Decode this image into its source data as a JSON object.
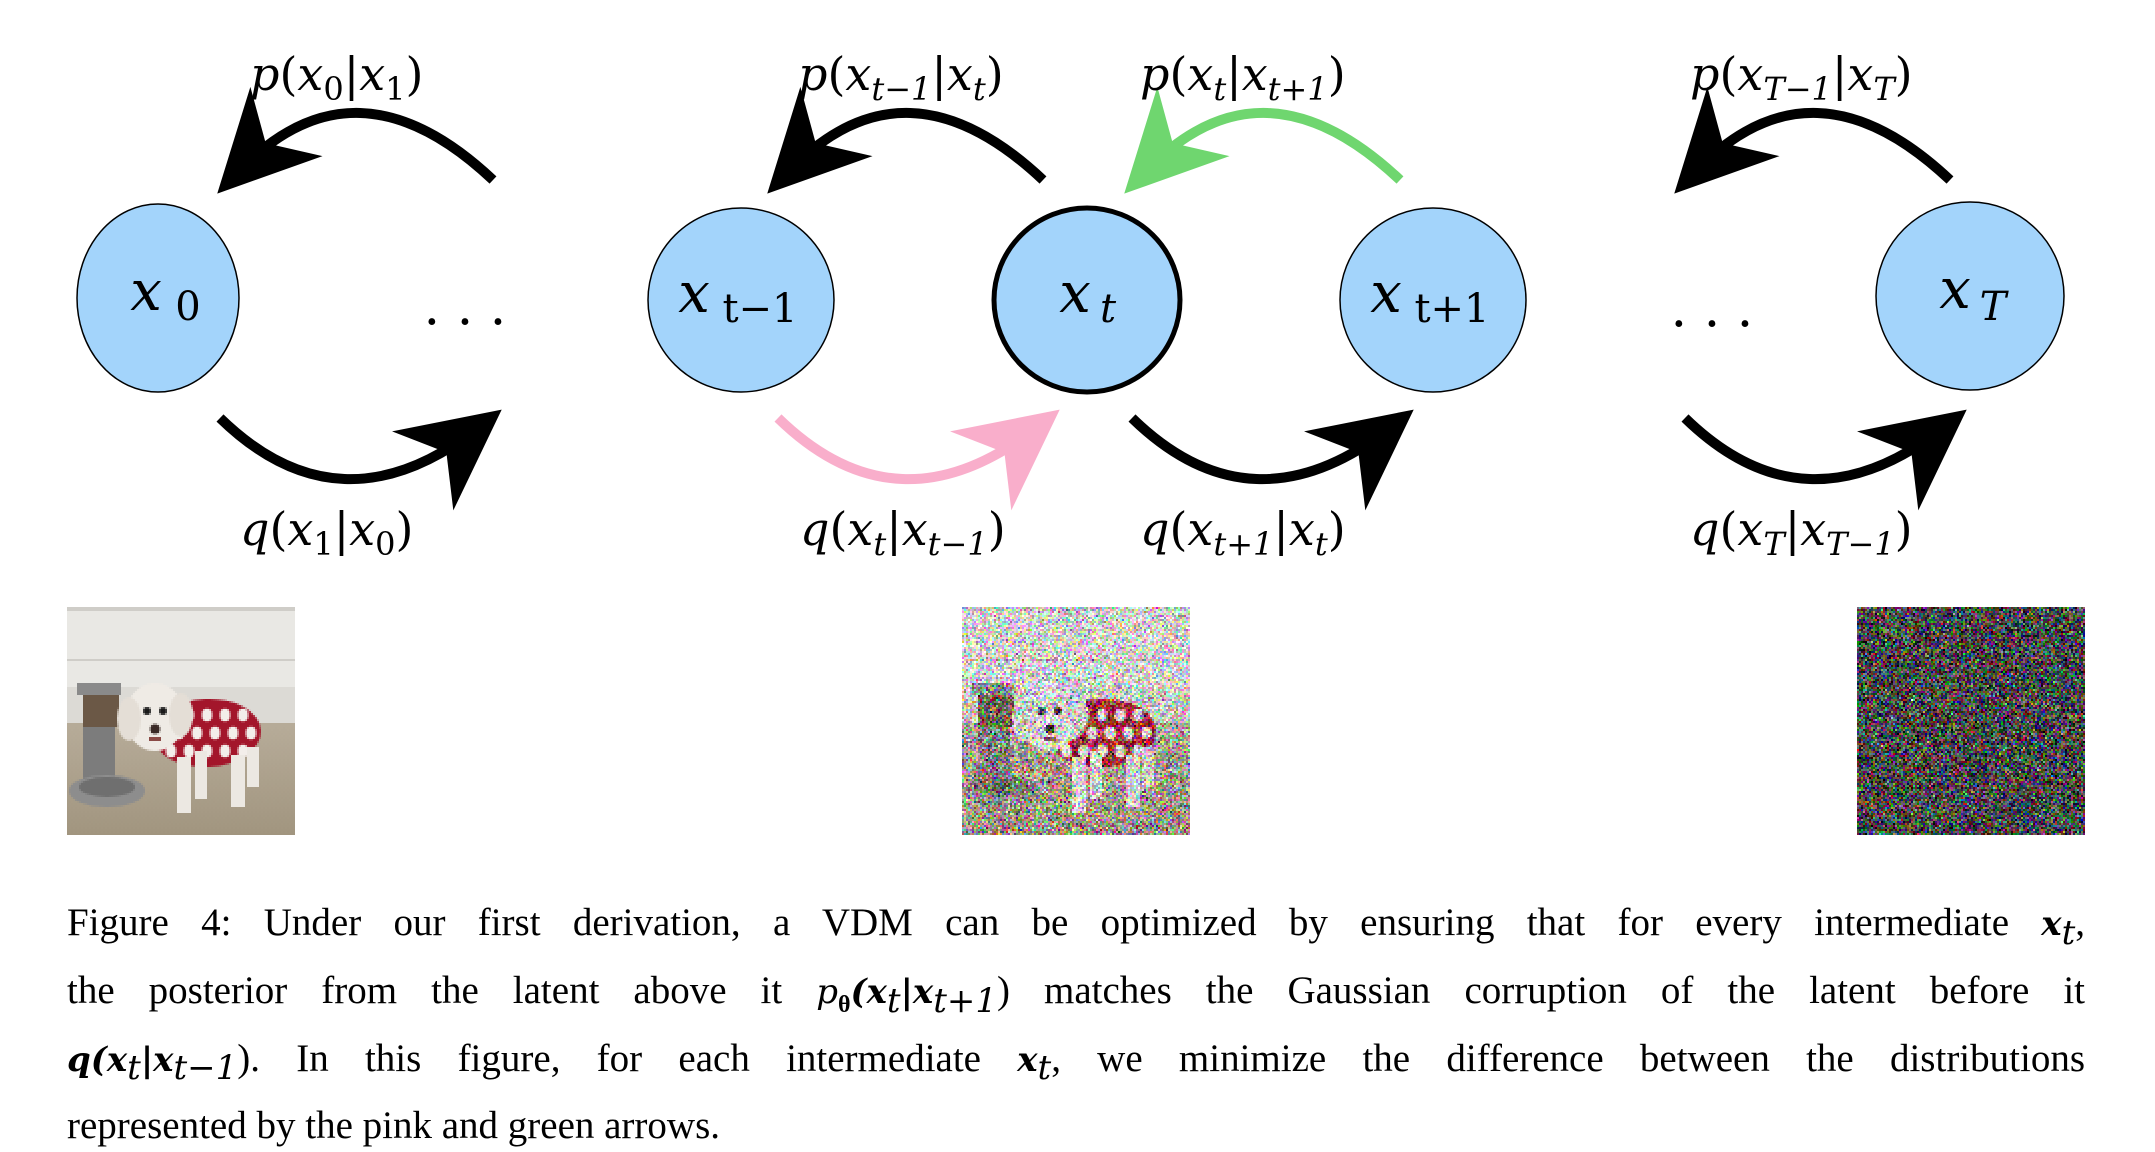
{
  "figure": {
    "nodes": [
      {
        "id": "x0",
        "label": "x",
        "sub": "0",
        "highlight": false
      },
      {
        "id": "xt-1",
        "label": "x",
        "sub": "t−1",
        "highlight": false
      },
      {
        "id": "xt",
        "label": "x",
        "sub": "t",
        "highlight": true
      },
      {
        "id": "xt+1",
        "label": "x",
        "sub": "t+1",
        "highlight": false
      },
      {
        "id": "xT",
        "label": "x",
        "sub": "T",
        "highlight": false
      }
    ],
    "ellipsis": "· · ·",
    "reverse_arrows": [
      {
        "label": "p(x₀|x₁)",
        "color": "#000000"
      },
      {
        "label": "p(xₜ₋₁|xₜ)",
        "color": "#000000"
      },
      {
        "label": "p(xₜ|xₜ₊₁)",
        "color": "#6fd66f"
      },
      {
        "label": "p(x_{T−1}|x_T)",
        "color": "#000000"
      }
    ],
    "forward_arrows": [
      {
        "label": "q(x₁|x₀)",
        "color": "#000000"
      },
      {
        "label": "q(xₜ|xₜ₋₁)",
        "color": "#f9aecb"
      },
      {
        "label": "q(xₜ₊₁|xₜ)",
        "color": "#000000"
      },
      {
        "label": "q(x_T|x_{T−1})",
        "color": "#000000"
      }
    ],
    "labels": {
      "p_x0_x1": {
        "f": "p",
        "a": "x",
        "as": "0",
        "b": "x",
        "bs": "1"
      },
      "p_xtm1_xt": {
        "f": "p",
        "a": "x",
        "as": "t−1",
        "b": "x",
        "bs": "t"
      },
      "p_xt_xtp1": {
        "f": "p",
        "a": "x",
        "as": "t",
        "b": "x",
        "bs": "t+1"
      },
      "p_xTm1_xT": {
        "f": "p",
        "a": "x",
        "as": "T−1",
        "b": "x",
        "bs": "T"
      },
      "q_x1_x0": {
        "f": "q",
        "a": "x",
        "as": "1",
        "b": "x",
        "bs": "0"
      },
      "q_xt_xtm1": {
        "f": "q",
        "a": "x",
        "as": "t",
        "b": "x",
        "bs": "t−1"
      },
      "q_xtp1_xt": {
        "f": "q",
        "a": "x",
        "as": "t+1",
        "b": "x",
        "bs": "t"
      },
      "q_xT_xTm1": {
        "f": "q",
        "a": "x",
        "as": "T",
        "b": "x",
        "bs": "T−1"
      }
    },
    "colors": {
      "node_fill": "#a3d4fb",
      "node_stroke": "#000000",
      "green_arrow": "#6fd66f",
      "pink_arrow": "#f9aecb",
      "black_arrow": "#000000"
    },
    "images": [
      {
        "name": "clean-dog-image",
        "description": "Photo of a white dog in a red polka-dot sweater beside a gray pet feeder",
        "noise_level": 0.0
      },
      {
        "name": "noisy-dog-image",
        "description": "Same dog photo with heavy Gaussian noise",
        "noise_level": 0.5
      },
      {
        "name": "pure-noise-image",
        "description": "Pure Gaussian noise",
        "noise_level": 1.0
      }
    ]
  },
  "caption": {
    "line1_text": "Figure 4: Under our first derivation, a VDM can be optimized by ensuring that for every intermediate ",
    "line1_math": "x",
    "line1_sub": "t",
    "line1_end": ",",
    "line2_a": "the posterior from the latent above it ",
    "line2_math": "p",
    "line2_math_sub": "θ",
    "line2_math_rest": "(x",
    "line2_s1": "t",
    "line2_mid": "|x",
    "line2_s2": "t+1",
    "line2_close": ")",
    "line2_b": " matches the Gaussian corruption of the latent before it",
    "line3_math": "q(x",
    "line3_s1": "t",
    "line3_mid": "|x",
    "line3_s2": "t−1",
    "line3_close": ").",
    "line3_b": " In this figure, for each intermediate ",
    "line3_math2": "x",
    "line3_s3": "t",
    "line3_c": ", we minimize the difference between the distributions",
    "line4": "represented by the pink and green arrows."
  }
}
